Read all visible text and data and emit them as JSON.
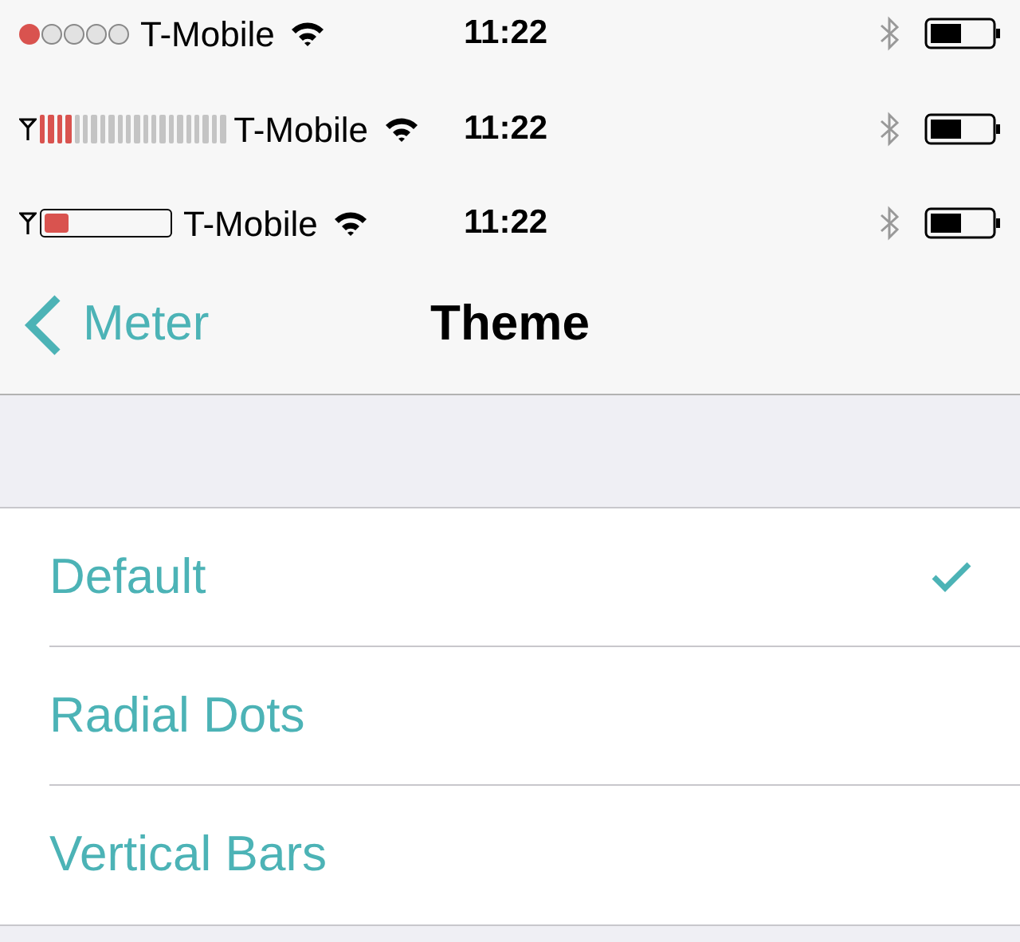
{
  "status_bars": [
    {
      "kind": "dots",
      "level": 0.2,
      "carrier": "T-Mobile",
      "time": "11:22"
    },
    {
      "kind": "bars",
      "level": 0.18,
      "carrier": "T-Mobile",
      "time": "11:22"
    },
    {
      "kind": "box",
      "level": 0.2,
      "carrier": "T-Mobile",
      "time": "11:22"
    }
  ],
  "nav_bar": {
    "back": "Meter",
    "title": "Theme"
  },
  "options": [
    {
      "label": "Default",
      "selected": true
    },
    {
      "label": "Radial Dots",
      "selected": false
    },
    {
      "label": "Vertical Bars",
      "selected": false
    }
  ]
}
